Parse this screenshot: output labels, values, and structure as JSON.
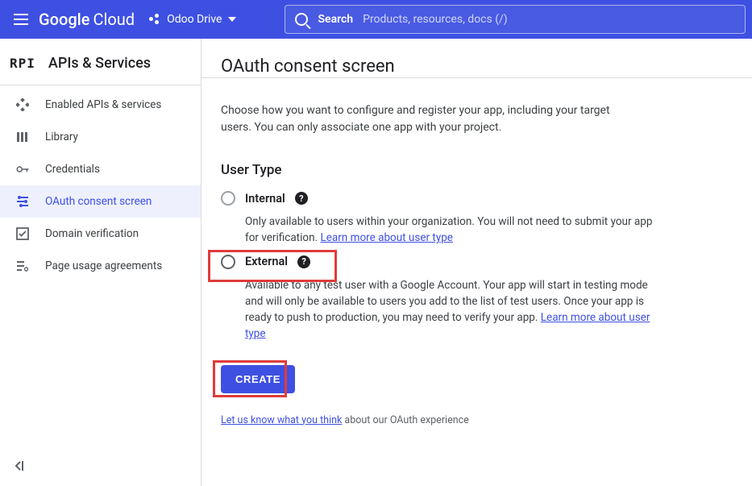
{
  "topbar": {
    "brand_left": "Google",
    "brand_right": "Cloud",
    "project_name": "Odoo Drive",
    "search_label": "Search",
    "search_placeholder": "Products, resources, docs (/)"
  },
  "sidebar": {
    "header_icon": "RPI",
    "header_label": "APIs & Services",
    "items": [
      {
        "icon": "diamond",
        "label": "Enabled APIs & services"
      },
      {
        "icon": "library",
        "label": "Library"
      },
      {
        "icon": "key",
        "label": "Credentials"
      },
      {
        "icon": "tune",
        "label": "OAuth consent screen",
        "active": true
      },
      {
        "icon": "check",
        "label": "Domain verification"
      },
      {
        "icon": "gear",
        "label": "Page usage agreements"
      }
    ]
  },
  "main": {
    "title": "OAuth consent screen",
    "intro": "Choose how you want to configure and register your app, including your target users. You can only associate one app with your project.",
    "section": "User Type",
    "option_internal": {
      "label": "Internal",
      "desc": "Only available to users within your organization. You will not need to submit your app for verification. ",
      "link": "Learn more about user type"
    },
    "option_external": {
      "label": "External",
      "desc": "Available to any test user with a Google Account. Your app will start in testing mode and will only be available to users you add to the list of test users. Once your app is ready to push to production, you may need to verify your app. ",
      "link": "Learn more about user type"
    },
    "create_label": "Create",
    "feedback_link": "Let us know what you think",
    "feedback_tail": " about our OAuth experience"
  }
}
